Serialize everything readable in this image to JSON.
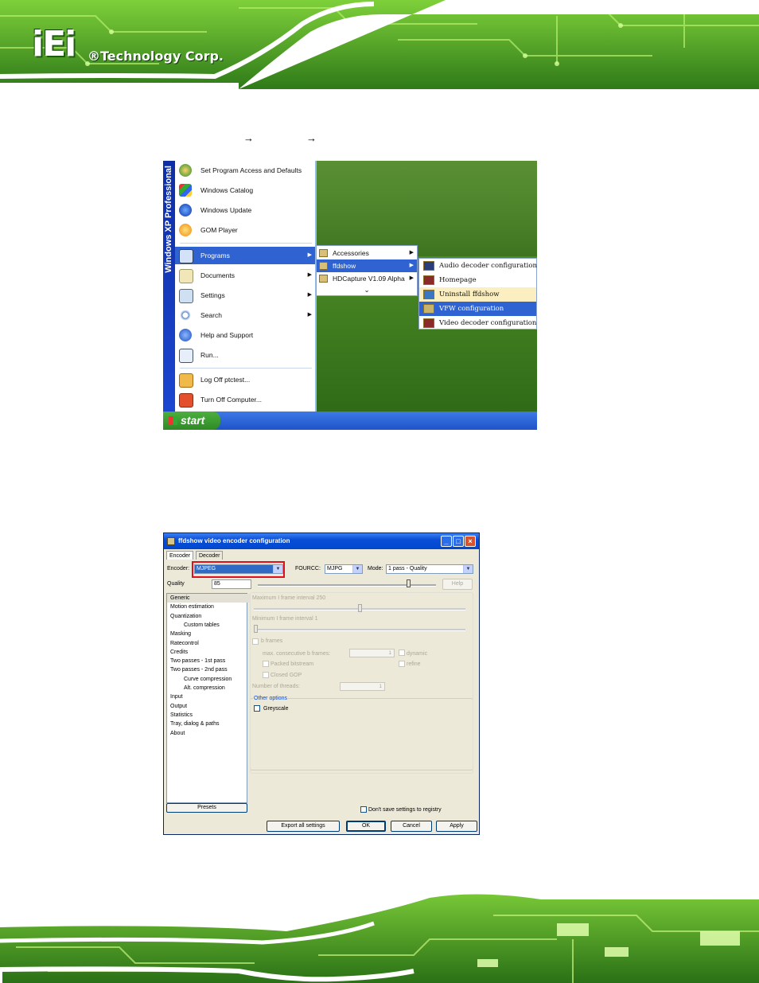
{
  "header": {
    "logo_mark": "iEi",
    "logo_text": "®Technology Corp."
  },
  "breadcrumb": {
    "arrow1": "→",
    "arrow2": "→"
  },
  "start_menu": {
    "side_band": "Windows XP Professional",
    "start_label": "start",
    "pinned": [
      {
        "label": "Set Program Access and Defaults",
        "icon": "program-access-icon"
      },
      {
        "label": "Windows Catalog",
        "icon": "windows-catalog-icon"
      },
      {
        "label": "Windows Update",
        "icon": "windows-update-icon"
      },
      {
        "label": "GOM Player",
        "icon": "gom-player-icon"
      }
    ],
    "items": [
      {
        "label": "Programs",
        "icon": "programs-icon",
        "arrow": "▶"
      },
      {
        "label": "Documents",
        "icon": "documents-icon",
        "arrow": "▶"
      },
      {
        "label": "Settings",
        "icon": "settings-icon",
        "arrow": "▶"
      },
      {
        "label": "Search",
        "icon": "search-icon",
        "arrow": "▶"
      },
      {
        "label": "Help and Support",
        "icon": "help-icon",
        "arrow": ""
      },
      {
        "label": "Run...",
        "icon": "run-icon",
        "arrow": ""
      }
    ],
    "session": [
      {
        "label": "Log Off ptctest...",
        "icon": "log-off-icon"
      },
      {
        "label": "Turn Off Computer...",
        "icon": "turn-off-icon"
      }
    ],
    "programs_submenu": [
      {
        "label": "Accessories",
        "arrow": "▶"
      },
      {
        "label": "ffdshow",
        "arrow": "▶"
      },
      {
        "label": "HDCapture V1.09 Alpha",
        "arrow": "▶"
      }
    ],
    "expand_glyph": "⌄",
    "ffdshow_submenu": [
      "Audio decoder configuration",
      "Homepage",
      "Uninstall ffdshow",
      "VFW configuration",
      "Video decoder configuration"
    ]
  },
  "dialog": {
    "title": "ffdshow video encoder configuration",
    "tabs": [
      "Encoder",
      "Decoder"
    ],
    "encoder_label": "Encoder:",
    "encoder_value": "MJPEG",
    "fourcc_label": "FOURCC:",
    "fourcc_value": "MJPG",
    "mode_label": "Mode:",
    "mode_value": "1 pass - Quality",
    "quality_label": "Quality",
    "quality_value": "85",
    "quality_fraction": 0.85,
    "help_label": "Help",
    "tree": [
      {
        "label": "Generic",
        "indent": 0,
        "selected": true
      },
      {
        "label": "Motion estimation",
        "indent": 0
      },
      {
        "label": "Quantization",
        "indent": 0
      },
      {
        "label": "Custom tables",
        "indent": 1
      },
      {
        "label": "Masking",
        "indent": 0
      },
      {
        "label": "Ratecontrol",
        "indent": 0
      },
      {
        "label": "Credits",
        "indent": 0
      },
      {
        "label": "Two passes - 1st pass",
        "indent": 0
      },
      {
        "label": "Two passes - 2nd pass",
        "indent": 0
      },
      {
        "label": "Curve compression",
        "indent": 1
      },
      {
        "label": "Alt. compression",
        "indent": 1
      },
      {
        "label": "Input",
        "indent": 0
      },
      {
        "label": "Output",
        "indent": 0
      },
      {
        "label": "Statistics",
        "indent": 0
      },
      {
        "label": "Tray, dialog & paths",
        "indent": 0
      },
      {
        "label": "About",
        "indent": 0
      }
    ],
    "max_iframe_label": "Maximum I frame interval 250",
    "min_iframe_label": "Minimum I frame interval 1",
    "bframes_label": "b frames",
    "max_bframes_label": "max. consecutive b frames:",
    "max_bframes_value": "1",
    "dynamic_label": "dynamic",
    "packed_label": "Packed bitstream",
    "refine_label": "refine",
    "closed_gop_label": "Closed GOP",
    "threads_label": "Number of threads:",
    "threads_value": "1",
    "other_options_label": "Other options",
    "greyscale_label": "Greyscale",
    "presets_label": "Presets",
    "dont_save_label": "Don't save settings to registry",
    "buttons": [
      "Export all settings",
      "OK",
      "Cancel",
      "Apply"
    ]
  },
  "colors": {
    "highlight": "#2f63d1",
    "callout": "#e0101e",
    "banner_green": "#5fb52a"
  }
}
